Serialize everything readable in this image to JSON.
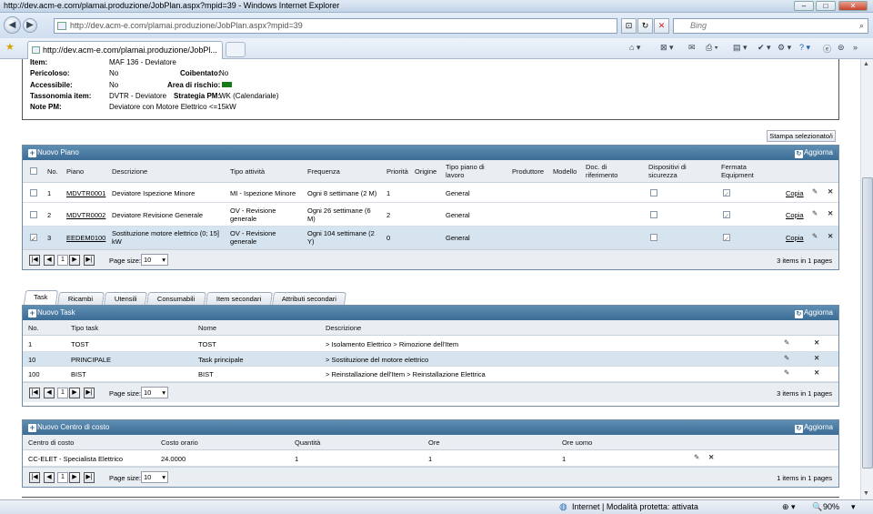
{
  "window": {
    "title": "http://dev.acm-e.com/plamai.produzione/JobPlan.aspx?mpid=39 - Windows Internet Explorer"
  },
  "address": {
    "url": "http://dev.acm-e.com/plamai.produzione/JobPlan.aspx?mpid=39",
    "search_placeholder": "Bing"
  },
  "tab": {
    "label": "http://dev.acm-e.com/plamai.produzione/JobPl..."
  },
  "item_info": {
    "item_label": "Item:",
    "item_value": "MAF 136 - Deviatore",
    "pericoloso_label": "Pericoloso:",
    "pericoloso_value": "No",
    "coibentato_label": "Coibentato:",
    "coibentato_value": "No",
    "accessibile_label": "Accessibile:",
    "accessibile_value": "No",
    "rischio_label": "Area di rischio:",
    "rischio_color": "#1a7a1a",
    "tassonomia_label": "Tassonomia item:",
    "tassonomia_value": "DVTR - Deviatore",
    "strategia_label": "Strategia PM:",
    "strategia_value": "WK (Calendariale)",
    "note_label": "Note PM:",
    "note_value": "Deviatore con Motore Elettrico <=15kW"
  },
  "stampa_button": "Stampa selezionato/i",
  "piano_grid": {
    "add_label": "Nuovo Piano",
    "refresh_label": "Aggiorna",
    "columns": [
      "No.",
      "Piano",
      "Descrizione",
      "Tipo attività",
      "Frequenza",
      "Priorità",
      "Origine",
      "Tipo piano di lavoro",
      "Produttore",
      "Modello",
      "Doc. di riferimento",
      "Dispositivi di sicurezza",
      "Fermata Equipment"
    ],
    "rows": [
      {
        "no": "1",
        "piano": "MDVTR0001",
        "descrizione": "Deviatore Ispezione Minore",
        "tipo_attivita": "MI - Ispezione Minore",
        "frequenza": "Ogni 8 settimane (2 M)",
        "priorita": "1",
        "tipo_piano": "General",
        "copia": "Copia",
        "checked": false
      },
      {
        "no": "2",
        "piano": "MDVTR0002",
        "descrizione": "Deviatore Revisione Generale",
        "tipo_attivita": "OV - Revisione generale",
        "frequenza": "Ogni 26 settimane (6 M)",
        "priorita": "2",
        "tipo_piano": "General",
        "copia": "Copia",
        "checked": false
      },
      {
        "no": "3",
        "piano": "EEDEM0100",
        "descrizione": "Sostituzione motore elettrico (0; 15] kW",
        "tipo_attivita": "OV - Revisione generale",
        "frequenza": "Ogni 104 settimane (2 Y)",
        "priorita": "0",
        "tipo_piano": "General",
        "copia": "Copia",
        "checked": true
      }
    ],
    "pager": {
      "page": "1",
      "page_size_label": "Page size:",
      "page_size": "10",
      "info": "3 items in 1 pages"
    }
  },
  "tabs": [
    "Task",
    "Ricambi",
    "Utensili",
    "Consumabili",
    "Item secondari",
    "Attributi secondari"
  ],
  "task_grid": {
    "add_label": "Nuovo Task",
    "refresh_label": "Aggiorna",
    "columns": [
      "No.",
      "Tipo task",
      "Nome",
      "Descrizione"
    ],
    "rows": [
      {
        "no": "1",
        "tipo": "TOST",
        "nome": "TOST",
        "descrizione": "> Isolamento Elettrico > Rimozione dell'Item"
      },
      {
        "no": "10",
        "tipo": "PRINCIPALE",
        "nome": "Task principale",
        "descrizione": "> Sostituzione del motore elettrico"
      },
      {
        "no": "100",
        "tipo": "BIST",
        "nome": "BIST",
        "descrizione": "> Reinstallazione dell'Item > Reinstallazione Elettrica"
      }
    ],
    "pager": {
      "page": "1",
      "page_size_label": "Page size:",
      "page_size": "10",
      "info": "3 items in 1 pages"
    }
  },
  "costo_grid": {
    "add_label": "Nuovo Centro di costo",
    "refresh_label": "Aggiorna",
    "columns": [
      "Centro di costo",
      "Costo orario",
      "Quantità",
      "Ore",
      "Ore uomo"
    ],
    "rows": [
      {
        "centro": "CC-ELET - Specialista Elettrico",
        "costo": "24.0000",
        "quantita": "1",
        "ore": "1",
        "ore_uomo": "1"
      }
    ],
    "pager": {
      "page": "1",
      "page_size_label": "Page size:",
      "page_size": "10",
      "info": "1 items in 1 pages"
    }
  },
  "status": {
    "zone": "Internet | Modalità protetta: attivata",
    "zoom": "90%"
  }
}
